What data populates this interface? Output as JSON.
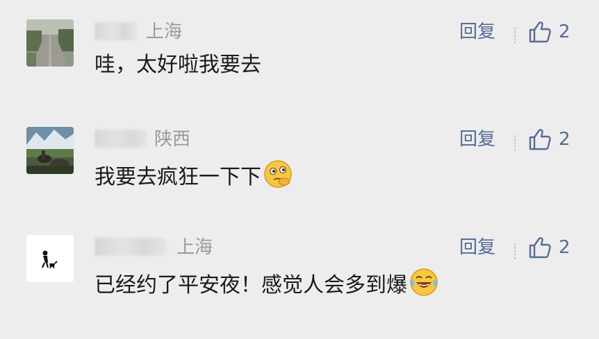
{
  "comments": [
    {
      "location": "上海",
      "text": "哇，太好啦我要去",
      "reply_label": "回复",
      "like_count": "2",
      "emoji": "",
      "avatar": "avatar-road-photo"
    },
    {
      "location": "陕西",
      "text": "我要去疯狂一下下",
      "reply_label": "回复",
      "like_count": "2",
      "emoji": "thinking-emoji",
      "avatar": "avatar-mountain-photo"
    },
    {
      "location": "上海",
      "text": "已经约了平安夜！感觉人会多到爆",
      "reply_label": "回复",
      "like_count": "2",
      "emoji": "laughing-tears-emoji",
      "avatar": "avatar-figure-with-dog"
    }
  ],
  "colors": {
    "background": "#ededed",
    "link": "#576b95",
    "location": "#9a9a9a",
    "text": "#1a1a1a"
  }
}
